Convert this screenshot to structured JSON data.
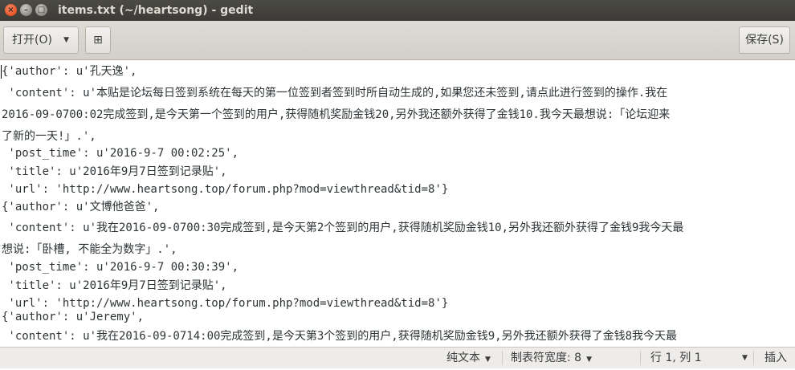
{
  "window": {
    "title": "items.txt (~/heartsong) - gedit",
    "close_glyph": "×",
    "minimize_glyph": "–",
    "maximize_glyph": "□"
  },
  "header": {
    "open_label": "打开(O)",
    "open_arrow": "▼",
    "new_tab_glyph": "⊞",
    "save_label": "保存(S)"
  },
  "document": {
    "lines": [
      "{'author': u'孔天逸',",
      " 'content': u'本贴是论坛每日签到系统在每天的第一位签到者签到时所自动生成的,如果您还未签到,请点此进行签到的操作.我在",
      "2016-09-0700:02完成签到,是今天第一个签到的用户,获得随机奖励金钱20,另外我还额外获得了金钱10.我今天最想说:「论坛迎来",
      "了新的一天!」.',",
      " 'post_time': u'2016-9-7 00:02:25',",
      " 'title': u'2016年9月7日签到记录贴',",
      " 'url': 'http://www.heartsong.top/forum.php?mod=viewthread&tid=8'}",
      "{'author': u'文博他爸爸',",
      " 'content': u'我在2016-09-0700:30完成签到,是今天第2个签到的用户,获得随机奖励金钱10,另外我还额外获得了金钱9我今天最",
      "想说:「卧槽, 不能全为数字」.',",
      " 'post_time': u'2016-9-7 00:30:39',",
      " 'title': u'2016年9月7日签到记录贴',",
      " 'url': 'http://www.heartsong.top/forum.php?mod=viewthread&tid=8'}",
      "{'author': u'Jeremy',",
      " 'content': u'我在2016-09-0714:00完成签到,是今天第3个签到的用户,获得随机奖励金钱9,另外我还额外获得了金钱8我今天最"
    ]
  },
  "statusbar": {
    "language": "纯文本",
    "tab_width": "制表符宽度: 8",
    "position": "行 1, 列 1",
    "mode": "插入",
    "arrow": "▼"
  }
}
